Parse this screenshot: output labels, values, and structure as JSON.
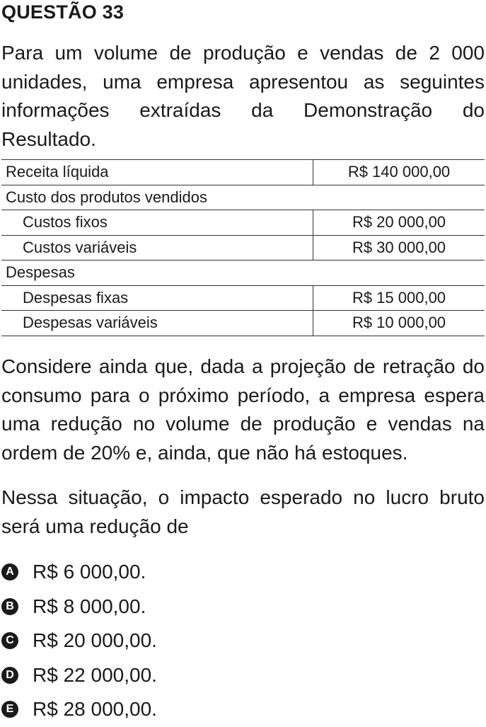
{
  "question": {
    "title": "QUESTÃO 33",
    "intro": "Para um volume de produção e vendas de 2 000 unidades, uma empresa apresentou as seguintes informações extraídas da Demonstração do Resultado.",
    "table": {
      "rows": [
        {
          "label": "Receita líquida",
          "value": "R$ 140 000,00"
        },
        {
          "label": "Custo dos produtos vendidos"
        },
        {
          "label": "Custos fixos",
          "value": "R$ 20 000,00"
        },
        {
          "label": "Custos variáveis",
          "value": "R$ 30 000,00"
        },
        {
          "label": "Despesas"
        },
        {
          "label": "Despesas fixas",
          "value": "R$ 15 000,00"
        },
        {
          "label": "Despesas variáveis",
          "value": "R$ 10 000,00"
        }
      ]
    },
    "context": "Considere ainda que, dada a projeção de retração do consumo para o próximo período, a empresa espera uma redução no volume de produção e vendas na ordem de 20% e, ainda, que não há estoques.",
    "prompt": "Nessa situação, o impacto esperado no lucro bruto será uma redução de",
    "options": [
      {
        "letter": "A",
        "text": "R$ 6 000,00."
      },
      {
        "letter": "B",
        "text": "R$ 8 000,00."
      },
      {
        "letter": "C",
        "text": "R$ 20 000,00."
      },
      {
        "letter": "D",
        "text": "R$ 22 000,00."
      },
      {
        "letter": "E",
        "text": "R$ 28 000,00."
      }
    ]
  }
}
